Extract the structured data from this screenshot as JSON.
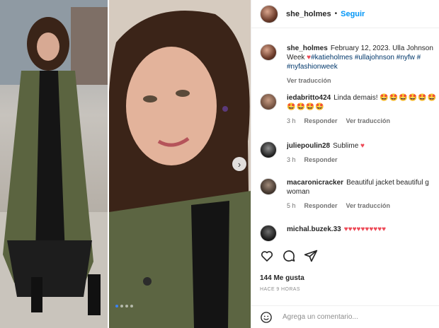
{
  "post": {
    "username": "she_holmes",
    "separator": "•",
    "follow_label": "Seguir"
  },
  "caption": {
    "username": "she_holmes",
    "text": "February 12, 2023. Ulla Johnson",
    "line2_text": "Week",
    "tags": [
      "#katieholmes",
      "#ullajohnson",
      "#nyfw",
      "#"
    ],
    "line3_tag": "#nyfashionweek",
    "translate_label": "Ver traducción"
  },
  "comments": [
    {
      "username": "iedabritto424",
      "text": "Linda demais!",
      "emoji_line1": "🤩🤩🤩🤩🤩🤩",
      "emoji_line2": "🤩🤩🤩🤩",
      "time": "3 h",
      "reply_label": "Responder",
      "translate_label": "Ver traducción"
    },
    {
      "username": "juliepoulin28",
      "text": "Sublime",
      "emoji": "♥",
      "time": "3 h",
      "reply_label": "Responder"
    },
    {
      "username": "macaronicracker",
      "text": "Beautiful jacket beautiful g",
      "line2": "woman",
      "time": "5 h",
      "reply_label": "Responder",
      "translate_label": "Ver traducción"
    },
    {
      "username": "michal.buzek.33",
      "emoji": "♥♥♥♥♥♥♥♥♥♥"
    }
  ],
  "actions": {
    "icons": [
      "heart-icon",
      "comment-icon",
      "share-icon"
    ]
  },
  "likes_label": "144 Me gusta",
  "timestamp": "HACE 9 HORAS",
  "comment_input": {
    "placeholder": "Agrega un comentario..."
  },
  "carousel": {
    "slides": 4,
    "active_index": 0,
    "next_glyph": "›"
  }
}
